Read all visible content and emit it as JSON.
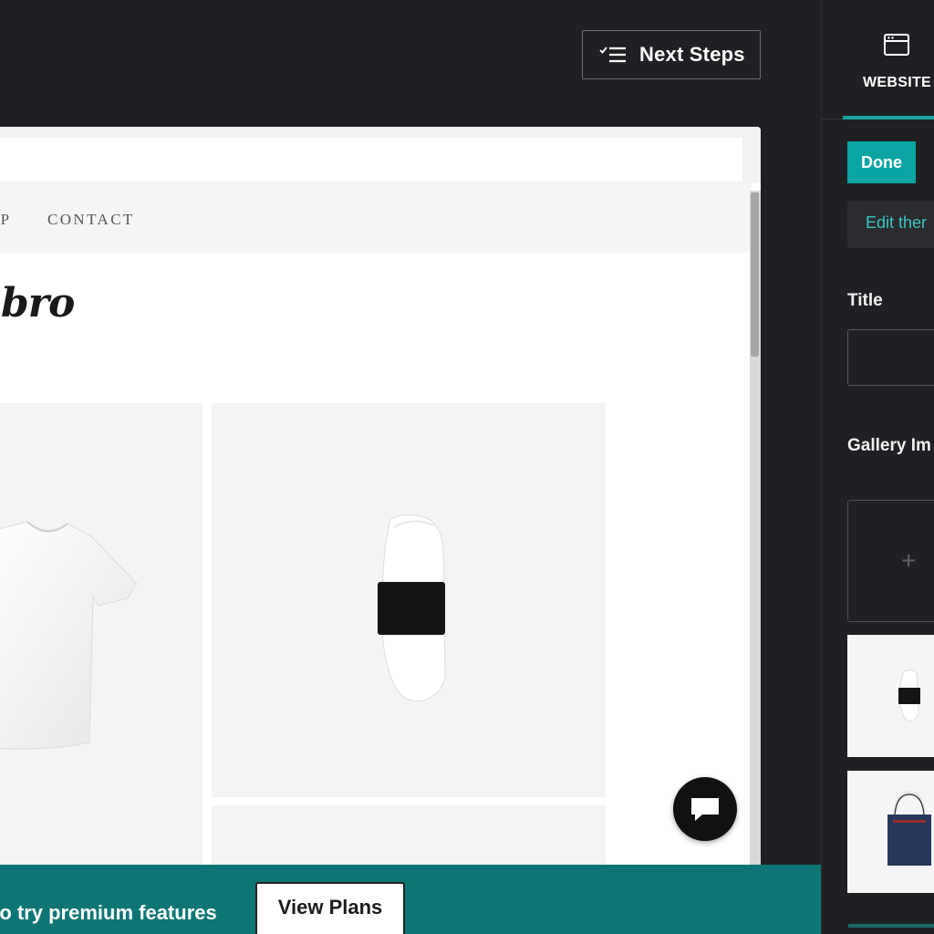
{
  "header": {
    "next_steps_label": "Next Steps"
  },
  "preview": {
    "nav": {
      "items": [
        "OP",
        "CONTACT"
      ]
    },
    "logo_text": "nbro",
    "gallery": [
      "t-shirt",
      "sock",
      "product"
    ]
  },
  "upsell": {
    "text": "to try premium features",
    "button_label": "View Plans"
  },
  "side_panel": {
    "tab_label": "WEBSITE",
    "done_label": "Done",
    "edit_theme_label": "Edit ther",
    "title_label": "Title",
    "title_value": "",
    "gallery_label": "Gallery Im",
    "add_symbol": "+"
  },
  "colors": {
    "accent": "#0aa5a2",
    "banner": "#0d7675",
    "dark_bg": "#1f2023",
    "link": "#3cc6c2"
  },
  "icons": {
    "next_steps": "checklist-icon",
    "website_tab": "browser-window-icon",
    "chat": "chat-bubble-icon",
    "add": "plus-icon"
  }
}
